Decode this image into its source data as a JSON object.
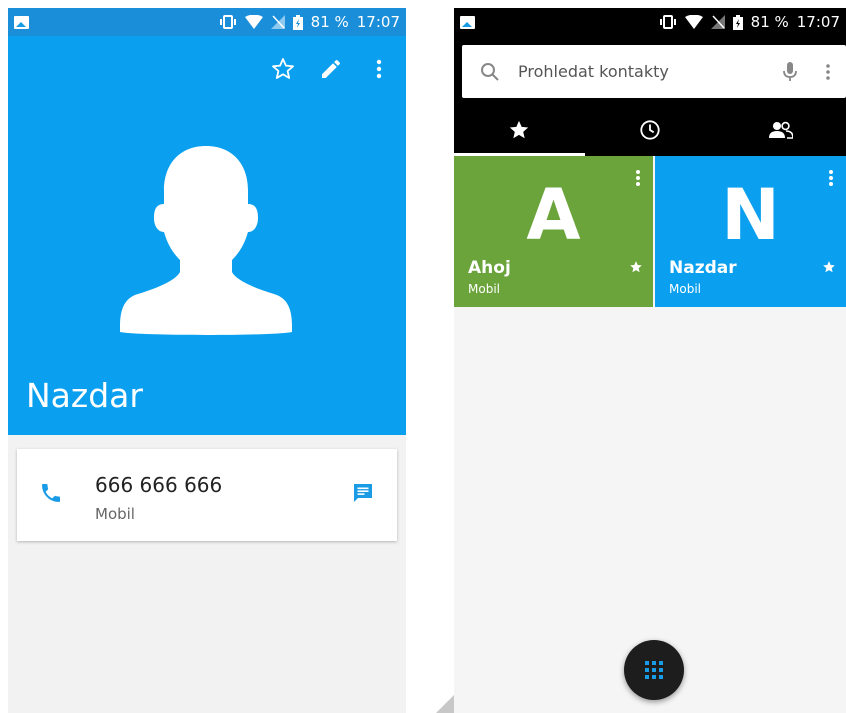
{
  "left": {
    "status": {
      "battery": "81 %",
      "time": "17:07"
    },
    "contact": {
      "name": "Nazdar"
    },
    "actions": {
      "favorite_icon": "star-outline-icon",
      "edit_icon": "pencil-icon",
      "more_icon": "more-vert-icon"
    },
    "phone": {
      "number": "666 666 666",
      "type": "Mobil"
    },
    "colors": {
      "header": "#0ba0ef",
      "status": "#1a8ed8",
      "accent": "#1a9be6"
    }
  },
  "right": {
    "status": {
      "battery": "81 %",
      "time": "17:07"
    },
    "search": {
      "placeholder": "Prohledat kontakty"
    },
    "tabs": [
      {
        "icon": "star-icon",
        "active": true
      },
      {
        "icon": "clock-icon",
        "active": false
      },
      {
        "icon": "people-icon",
        "active": false
      }
    ],
    "favorites": [
      {
        "letter": "A",
        "name": "Ahoj",
        "type": "Mobil",
        "color": "#6aa43b"
      },
      {
        "letter": "N",
        "name": "Nazdar",
        "type": "Mobil",
        "color": "#0ba0ef"
      }
    ]
  }
}
